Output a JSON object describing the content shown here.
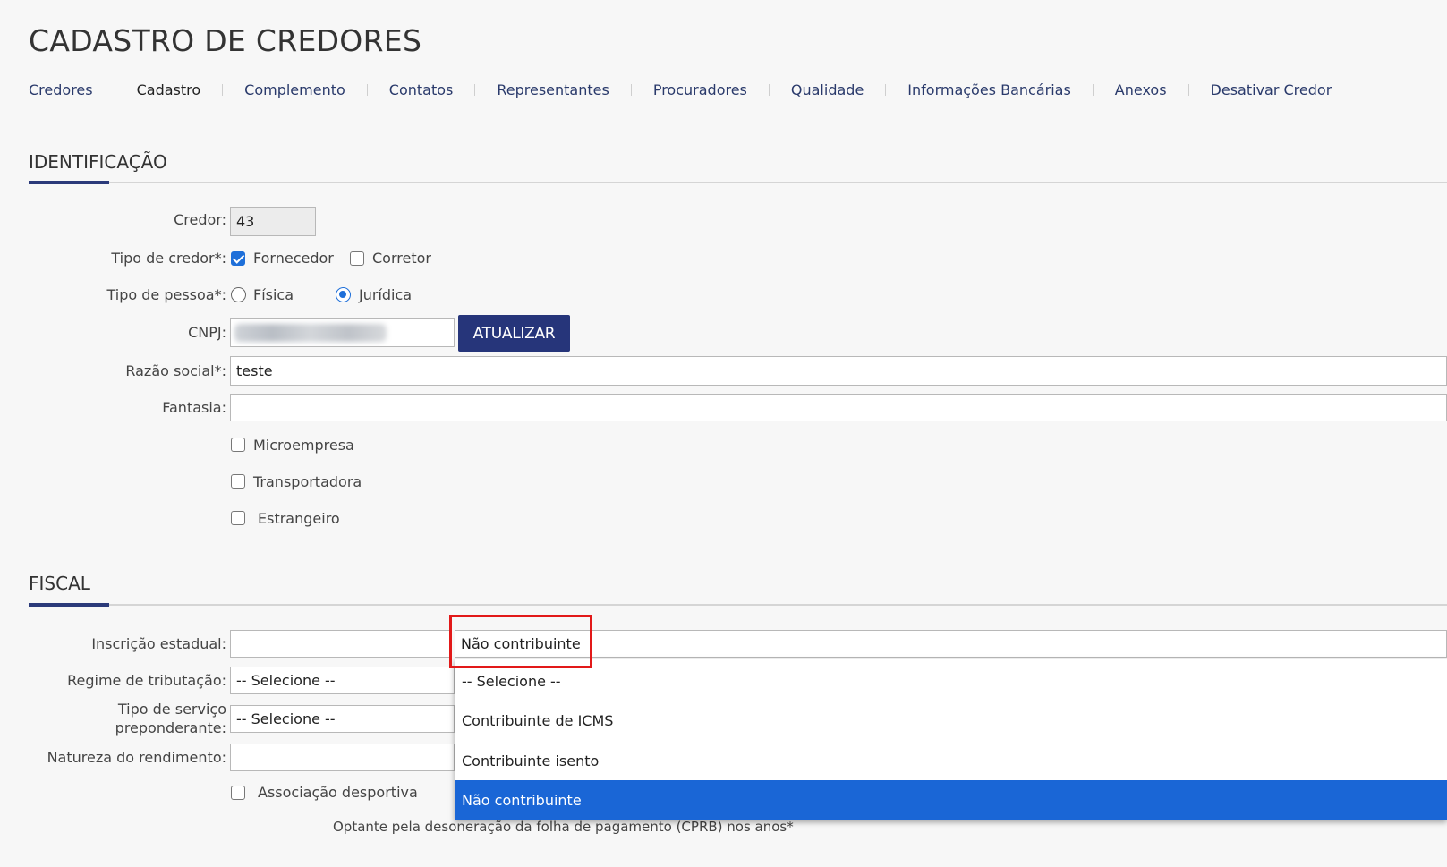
{
  "page": {
    "title": "CADASTRO DE CREDORES"
  },
  "nav": {
    "items": [
      "Credores",
      "Cadastro",
      "Complemento",
      "Contatos",
      "Representantes",
      "Procuradores",
      "Qualidade",
      "Informações Bancárias",
      "Anexos",
      "Desativar Credor"
    ],
    "active": "Cadastro"
  },
  "identificacao": {
    "title": "IDENTIFICAÇÃO",
    "credor": {
      "label": "Credor:",
      "value": "43"
    },
    "tipo_credor": {
      "label": "Tipo de credor*:",
      "options": [
        {
          "label": "Fornecedor",
          "checked": true
        },
        {
          "label": "Corretor",
          "checked": false
        }
      ]
    },
    "tipo_pessoa": {
      "label": "Tipo de pessoa*:",
      "options": [
        {
          "label": "Física",
          "selected": false
        },
        {
          "label": "Jurídica",
          "selected": true
        }
      ]
    },
    "cnpj": {
      "label": "CNPJ:",
      "button": "ATUALIZAR"
    },
    "razao_social": {
      "label": "Razão social*:",
      "value": "teste"
    },
    "fantasia": {
      "label": "Fantasia:",
      "value": ""
    },
    "checkboxes": [
      {
        "label": "Microempresa",
        "checked": false
      },
      {
        "label": "Transportadora",
        "checked": false
      },
      {
        "label": "Estrangeiro",
        "checked": false
      }
    ]
  },
  "fiscal": {
    "title": "FISCAL",
    "inscricao_estadual": {
      "label": "Inscrição estadual:",
      "value": "",
      "select_value": "Não contribuinte"
    },
    "regime_tributacao": {
      "label": "Regime de tributação:",
      "value": "-- Selecione --"
    },
    "tipo_servico": {
      "label": "Tipo de serviço preponderante:",
      "value": "-- Selecione --"
    },
    "natureza_rendimento": {
      "label": "Natureza do rendimento:",
      "value": ""
    },
    "associacao": {
      "label": "Associação desportiva",
      "checked": false
    },
    "cprb_text": "Optante pela desoneração da folha de pagamento (CPRB) nos anos*"
  },
  "dropdown": {
    "options": [
      "-- Selecione --",
      "Contribuinte de ICMS",
      "Contribuinte isento",
      "Não contribuinte"
    ],
    "selected": "Não contribuinte"
  }
}
